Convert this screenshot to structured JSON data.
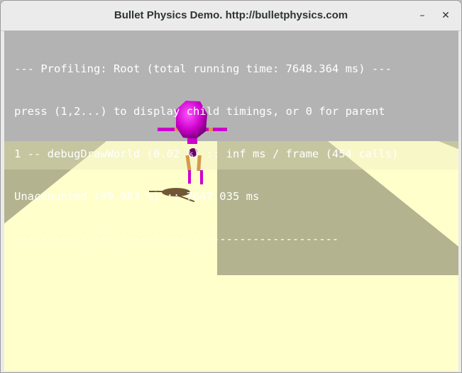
{
  "window": {
    "title": "Bullet Physics Demo. http://bulletphysics.com",
    "minimize_glyph": "–",
    "close_glyph": "✕"
  },
  "profiler": {
    "header": "--- Profiling: Root (total running time: 7648.364 ms) ---",
    "instructions": "press (1,2...) to display child timings, or 0 for parent",
    "entry_1": "1 -- debugDrawWorld (0.02 %) :: inf ms / frame (454 calls)",
    "unaccounted": "Unaccounted (99.983 %) :: 7647.035 ms",
    "separator": "-------------------------------------------------"
  },
  "colors": {
    "sky": "#b3b3b3",
    "floor_light": "#ffffcc",
    "floor_dark": "#b3b38f",
    "body": "#cc00cc",
    "limb": "#d49a4a",
    "shadow": "#5a3a1a"
  }
}
